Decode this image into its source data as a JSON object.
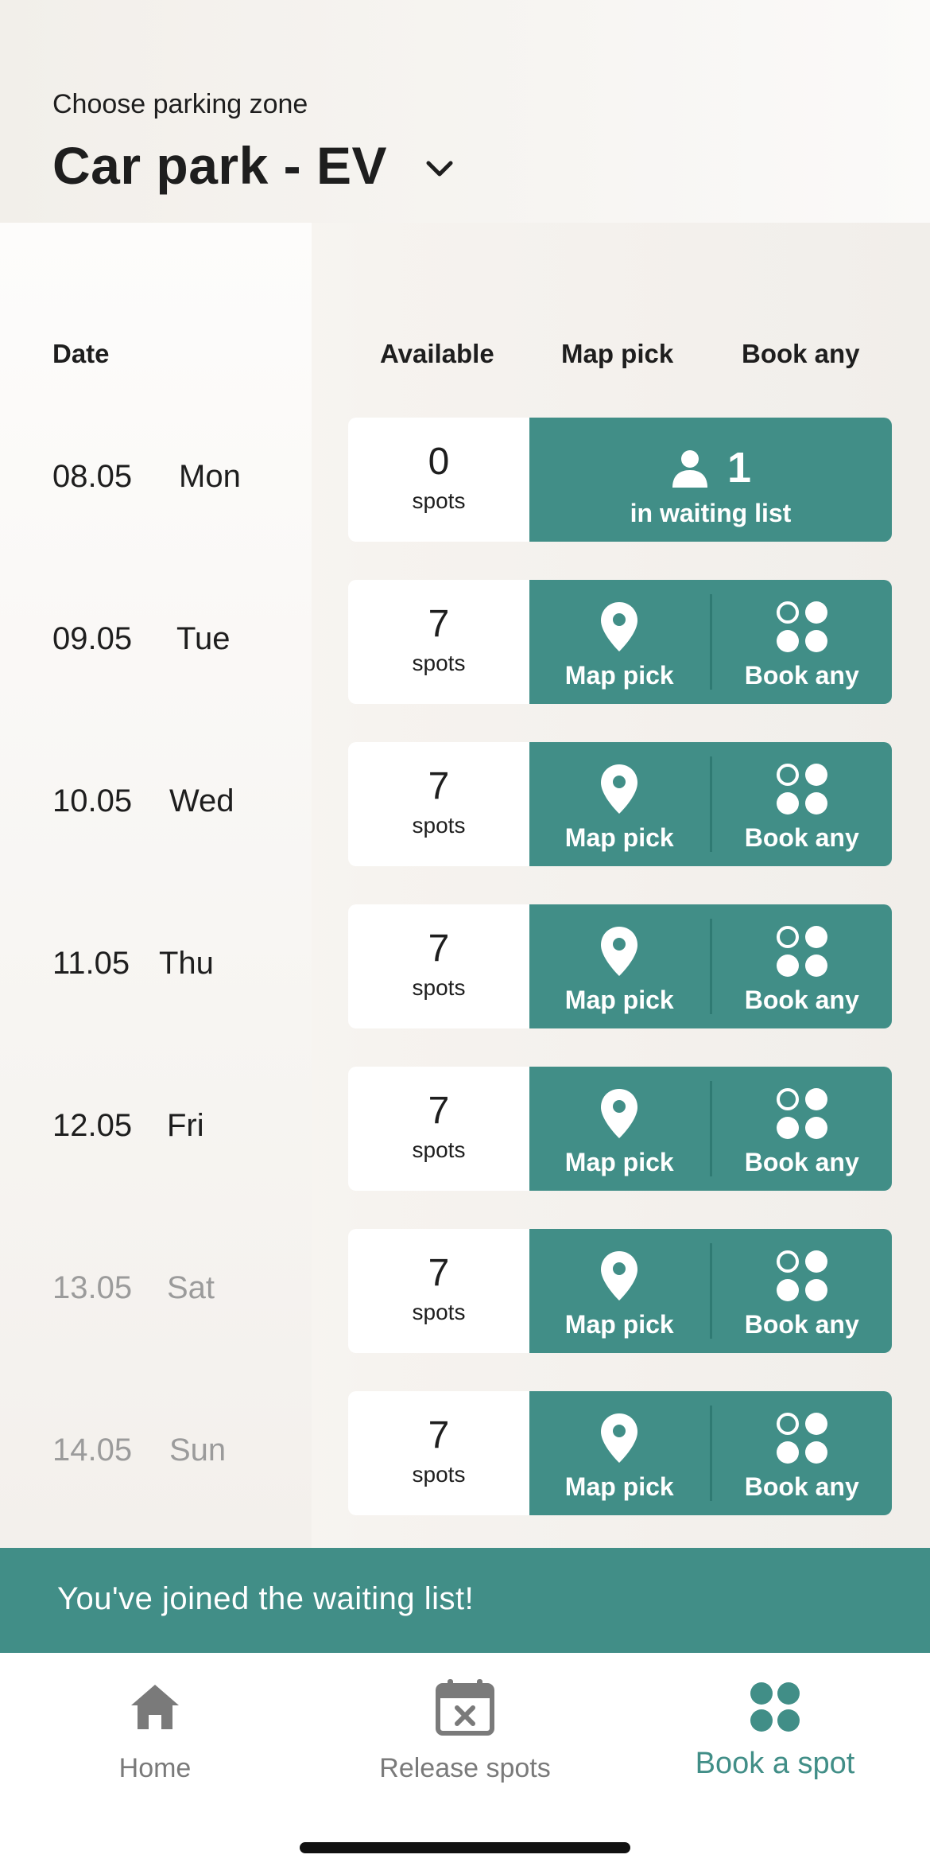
{
  "header": {
    "zone_label": "Choose parking zone",
    "zone_name": "Car park - EV"
  },
  "columns": {
    "date": "Date",
    "available": "Available",
    "map_pick": "Map pick",
    "book_any": "Book any"
  },
  "rows": [
    {
      "date": "08.05",
      "day": "Mon",
      "spots": "0",
      "unit": "spots",
      "waiting_count": "1",
      "waiting_label": "in waiting list"
    },
    {
      "date": "09.05",
      "day": "Tue",
      "spots": "7",
      "unit": "spots",
      "map_label": "Map pick",
      "book_label": "Book any"
    },
    {
      "date": "10.05",
      "day": "Wed",
      "spots": "7",
      "unit": "spots",
      "map_label": "Map pick",
      "book_label": "Book any"
    },
    {
      "date": "11.05",
      "day": "Thu",
      "spots": "7",
      "unit": "spots",
      "map_label": "Map pick",
      "book_label": "Book any"
    },
    {
      "date": "12.05",
      "day": "Fri",
      "spots": "7",
      "unit": "spots",
      "map_label": "Map pick",
      "book_label": "Book any"
    },
    {
      "date": "13.05",
      "day": "Sat",
      "spots": "7",
      "unit": "spots",
      "map_label": "Map pick",
      "book_label": "Book any"
    },
    {
      "date": "14.05",
      "day": "Sun",
      "spots": "7",
      "unit": "spots",
      "map_label": "Map pick",
      "book_label": "Book any"
    }
  ],
  "toast": {
    "message": "You've joined the waiting list!"
  },
  "tabbar": {
    "home": "Home",
    "release": "Release spots",
    "book": "Book a spot"
  },
  "colors": {
    "accent": "#418e87",
    "text": "#1e1e1e",
    "muted": "#9b9b9b",
    "tab_inactive": "#7a7a7a"
  }
}
